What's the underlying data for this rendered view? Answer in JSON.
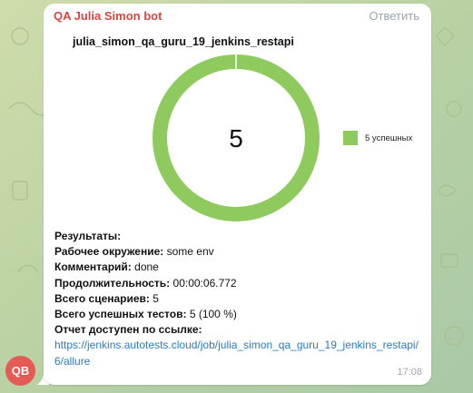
{
  "chat": {
    "sender": "QA Julia Simon bot",
    "reply_label": "Ответить",
    "avatar_initials": "QB",
    "time": "17:08"
  },
  "chart_data": {
    "type": "pie",
    "title": "julia_simon_qa_guru_19_jenkins_restapi",
    "center_label": "5",
    "slices": [
      {
        "label": "5 успешных",
        "value": 5,
        "color": "#8fca5e"
      }
    ],
    "legend_position": "right"
  },
  "report": {
    "results_heading": "Результаты:",
    "lines": [
      {
        "label": "Рабочее окружение:",
        "value": "some env"
      },
      {
        "label": "Комментарий:",
        "value": "done"
      },
      {
        "label": "Продолжительность:",
        "value": "00:00:06.772"
      },
      {
        "label": "Всего сценариев:",
        "value": "5"
      },
      {
        "label": "Всего успешных тестов:",
        "value": "5 (100 %)"
      }
    ],
    "link_heading": "Отчет доступен по ссылке:",
    "link_text": "https://jenkins.autotests.cloud/job/julia_simon_qa_guru_19_jenkins_restapi/6/allure"
  },
  "colors": {
    "wallpaper": "#c5d7a8",
    "sender": "#d5473f",
    "link": "#2b7bc2",
    "chart_green": "#8fca5e"
  }
}
